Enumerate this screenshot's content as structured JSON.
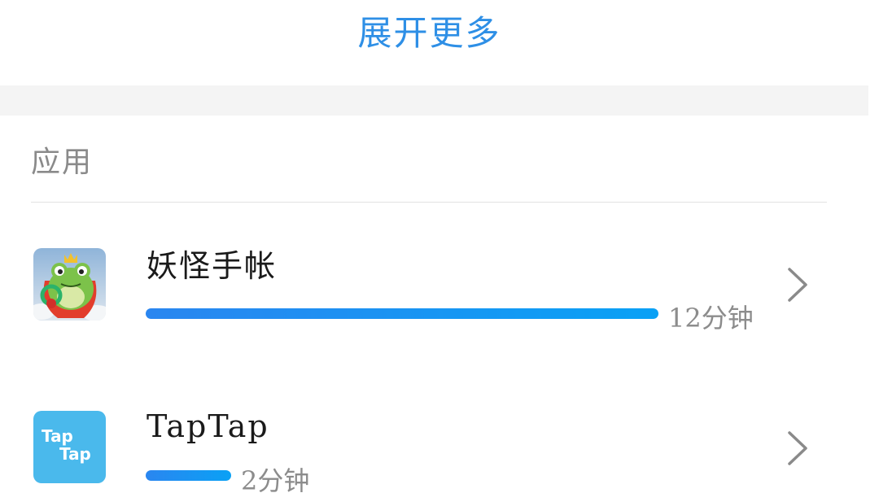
{
  "expand_more_label": "展开更多",
  "section": {
    "title": "应用"
  },
  "apps": [
    {
      "name": "妖怪手帐",
      "time_label": "12分钟",
      "usage_fraction": 1.0,
      "icon": "frog-character-game-icon"
    },
    {
      "name": "TapTap",
      "time_label": "2分钟",
      "usage_fraction": 0.167,
      "icon": "taptap-logo-icon",
      "icon_text_top": "Tap",
      "icon_text_bottom": "Tap",
      "icon_color": "#4ab9ec"
    }
  ],
  "colors": {
    "accent": "#2e8fe6",
    "bar_start": "#2a86f0",
    "bar_end": "#0aa1f5"
  }
}
